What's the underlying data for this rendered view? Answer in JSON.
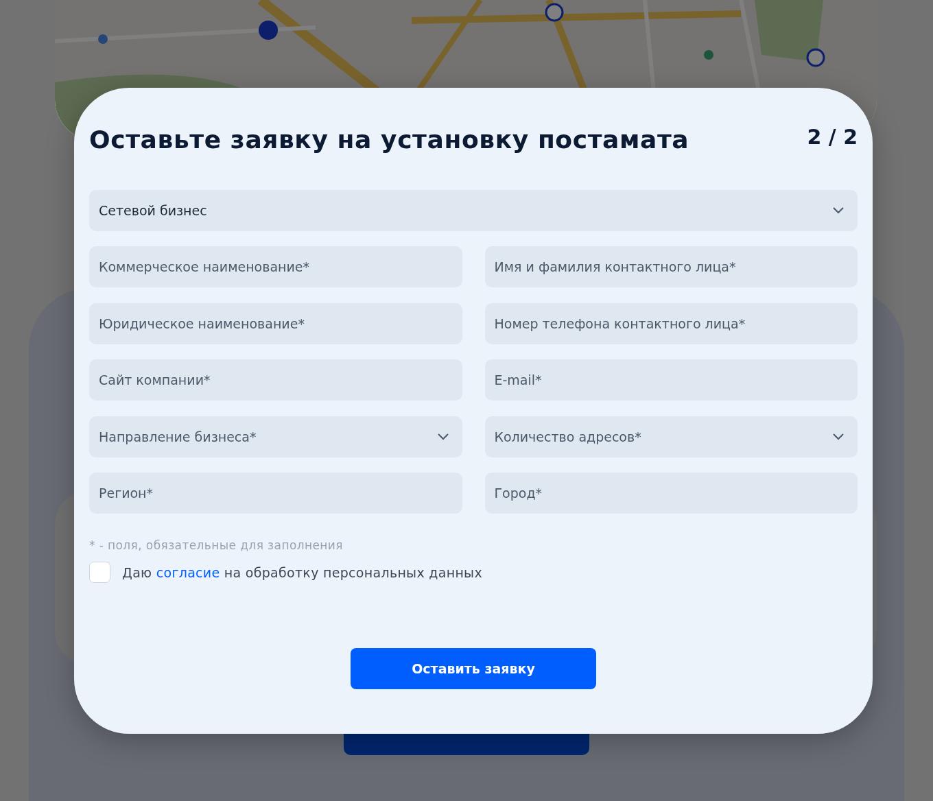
{
  "modal": {
    "title": "Оставьте заявку на установку постамата",
    "step": "2 / 2"
  },
  "business_type": {
    "kind": "select",
    "value": "Сетевой бизнес"
  },
  "fields": [
    {
      "kind": "input",
      "placeholder": "Коммерческое наименование*"
    },
    {
      "kind": "input",
      "placeholder": "Имя и фамилия контактного лица*"
    },
    {
      "kind": "input",
      "placeholder": "Юридическое наименование*"
    },
    {
      "kind": "input",
      "placeholder": "Номер телефона контактного лица*"
    },
    {
      "kind": "input",
      "placeholder": "Сайт компании*"
    },
    {
      "kind": "input",
      "placeholder": "E-mail*"
    },
    {
      "kind": "select",
      "placeholder": "Направление бизнеса*"
    },
    {
      "kind": "select",
      "placeholder": "Количество адресов*"
    },
    {
      "kind": "input",
      "placeholder": "Регион*"
    },
    {
      "kind": "input",
      "placeholder": "Город*"
    }
  ],
  "required_note": "* - поля, обязательные для заполнения",
  "consent": {
    "checked": false,
    "text_before": "Даю",
    "link": "согласие",
    "text_after": "на обработку персональных данных"
  },
  "submit_button": "Оставить заявку"
}
